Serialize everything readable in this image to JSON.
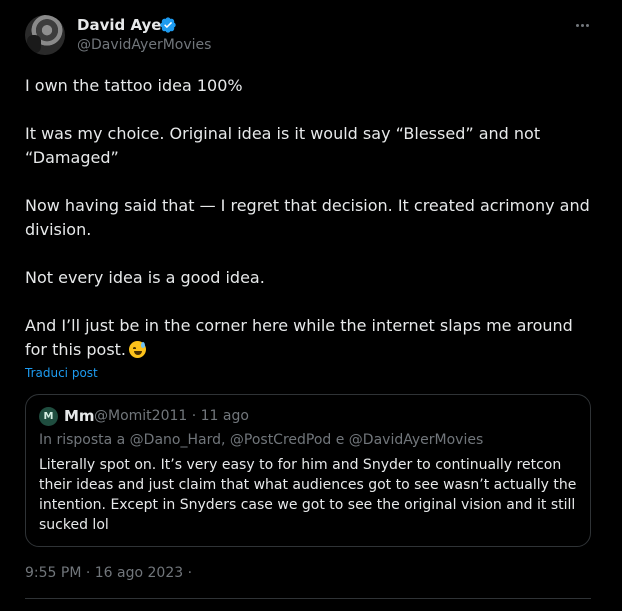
{
  "author": {
    "name": "David Ayer",
    "handle": "@DavidAyerMovies",
    "verified": true
  },
  "tweet": {
    "paragraphs": [
      "I own the tattoo idea 100%",
      "It was my choice. Original idea is it would say “Blessed” and not “Damaged”",
      "Now having said that — I regret that decision. It created acrimony and division.",
      "Not every idea is a good idea.",
      "And I’ll just be in the corner here while the internet slaps me around for this post."
    ],
    "emoji": "grinning-face-with-sweat",
    "translate_label": "Traduci post"
  },
  "quoted": {
    "avatar_initial": "M",
    "name": "Mm",
    "meta": "@Momit2011 · 11 ago",
    "reply_to": "In risposta a @Dano_Hard, @PostCredPod e @DavidAyerMovies",
    "text": "Literally spot on. It’s very easy to for him and Snyder to continually retcon their ideas and just claim that what audiences got to see wasn’t actually the intention. Except in Snyders case we got to see the original vision and it still sucked lol"
  },
  "timestamp": "9:55 PM · 16 ago 2023 ·",
  "colors": {
    "background": "#000000",
    "text": "#e7e9ea",
    "muted": "#71767b",
    "link": "#1d9bf0",
    "border": "#2f3336",
    "verified": "#1d9bf0"
  }
}
